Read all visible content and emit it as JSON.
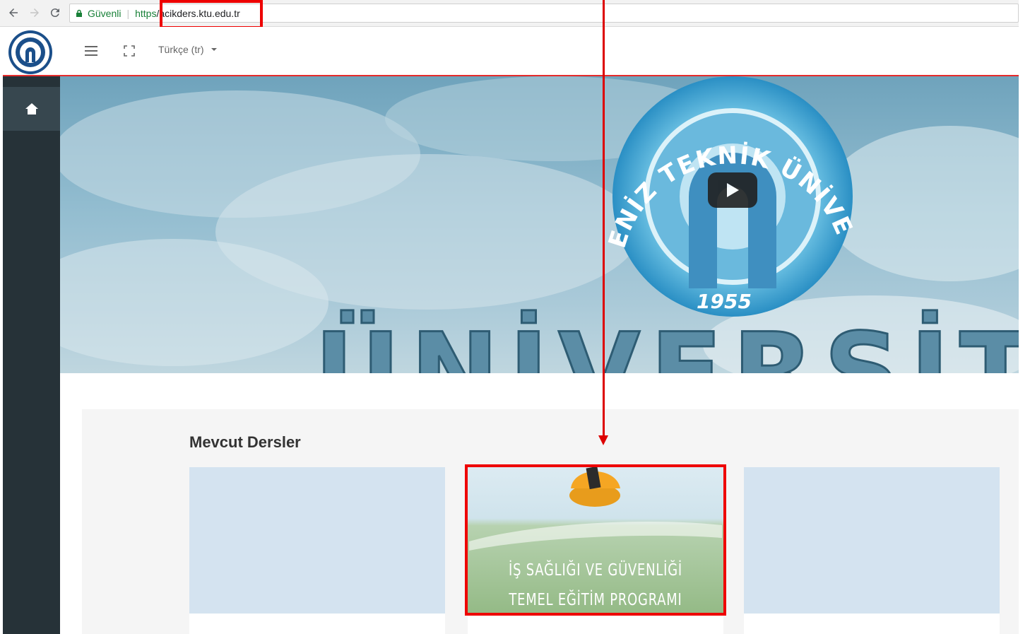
{
  "browser": {
    "secure_label": "Güvenli",
    "url_scheme": "https",
    "url_host": "/acikders.ktu.edu.tr"
  },
  "header": {
    "language": "Türkçe (tr)"
  },
  "hero": {
    "logo_arc_text": "KARADENİZ TEKNİK ÜNİVERSİTESİ",
    "logo_year": "1955",
    "banner_text": "ÜNİVERSİTE"
  },
  "content": {
    "section_title": "Mevcut Dersler",
    "courses": [
      {
        "image_lines": []
      },
      {
        "image_lines": [
          "İŞ SAĞLIĞI VE GÜVENLİĞİ",
          "TEMEL EĞİTİM PROGRAMI"
        ]
      },
      {
        "image_lines": []
      }
    ]
  },
  "colors": {
    "accent_red": "#e52b2b",
    "sidebar_bg": "#263238",
    "annotation": "#ee0000"
  }
}
